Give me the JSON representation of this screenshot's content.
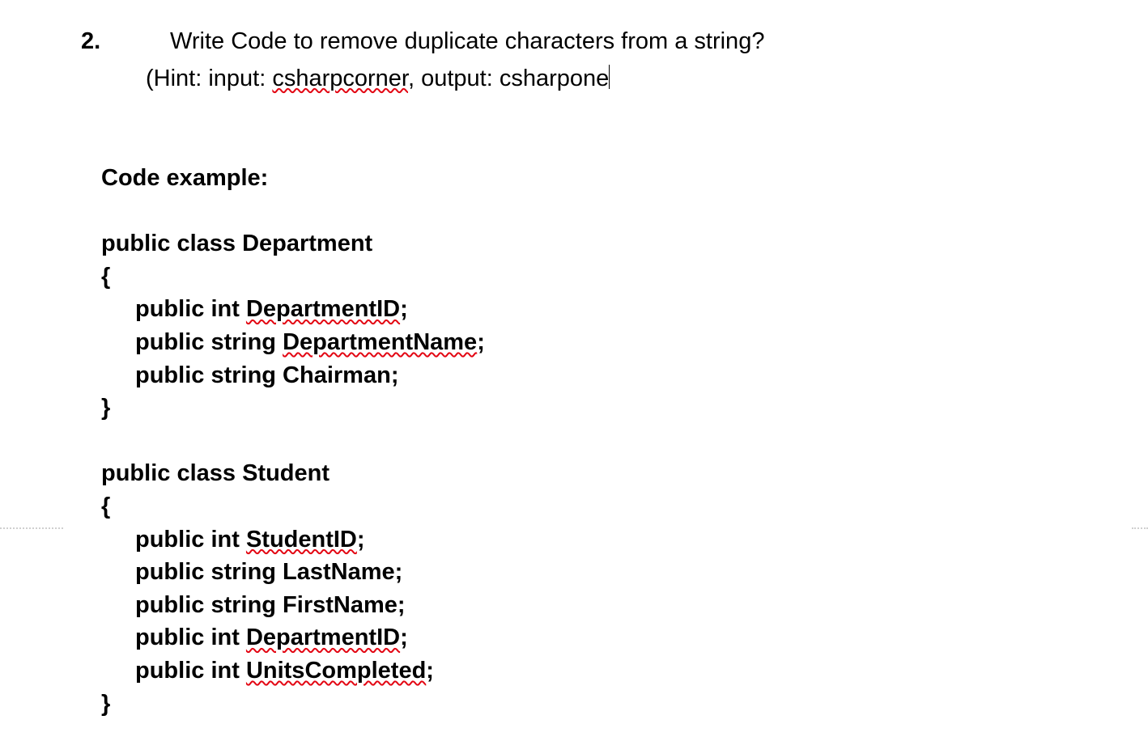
{
  "question": {
    "number": "2.",
    "prompt": "Write Code to remove duplicate characters from a string?",
    "hint_prefix": "(Hint: input: ",
    "hint_input": "csharpcorner",
    "hint_mid": ", output: ",
    "hint_output": "csharpone"
  },
  "code": {
    "heading": "Code example:",
    "blank": " ",
    "dept_decl": "public class Department",
    "brace_open": "{",
    "dept_f1a": "public int ",
    "dept_f1b": "DepartmentID",
    "semicolon": ";",
    "dept_f2a": "public string ",
    "dept_f2b": "DepartmentName",
    "dept_f3": "public string Chairman;",
    "brace_close": "}",
    "student_decl": "public class Student",
    "stu_f1a": "public int ",
    "stu_f1b": "StudentID",
    "stu_f2": "public string LastName;",
    "stu_f3": "public string FirstName;",
    "stu_f4a": "public int ",
    "stu_f4b": "DepartmentID",
    "stu_f5a": "public int ",
    "stu_f5b": "UnitsCompleted"
  }
}
